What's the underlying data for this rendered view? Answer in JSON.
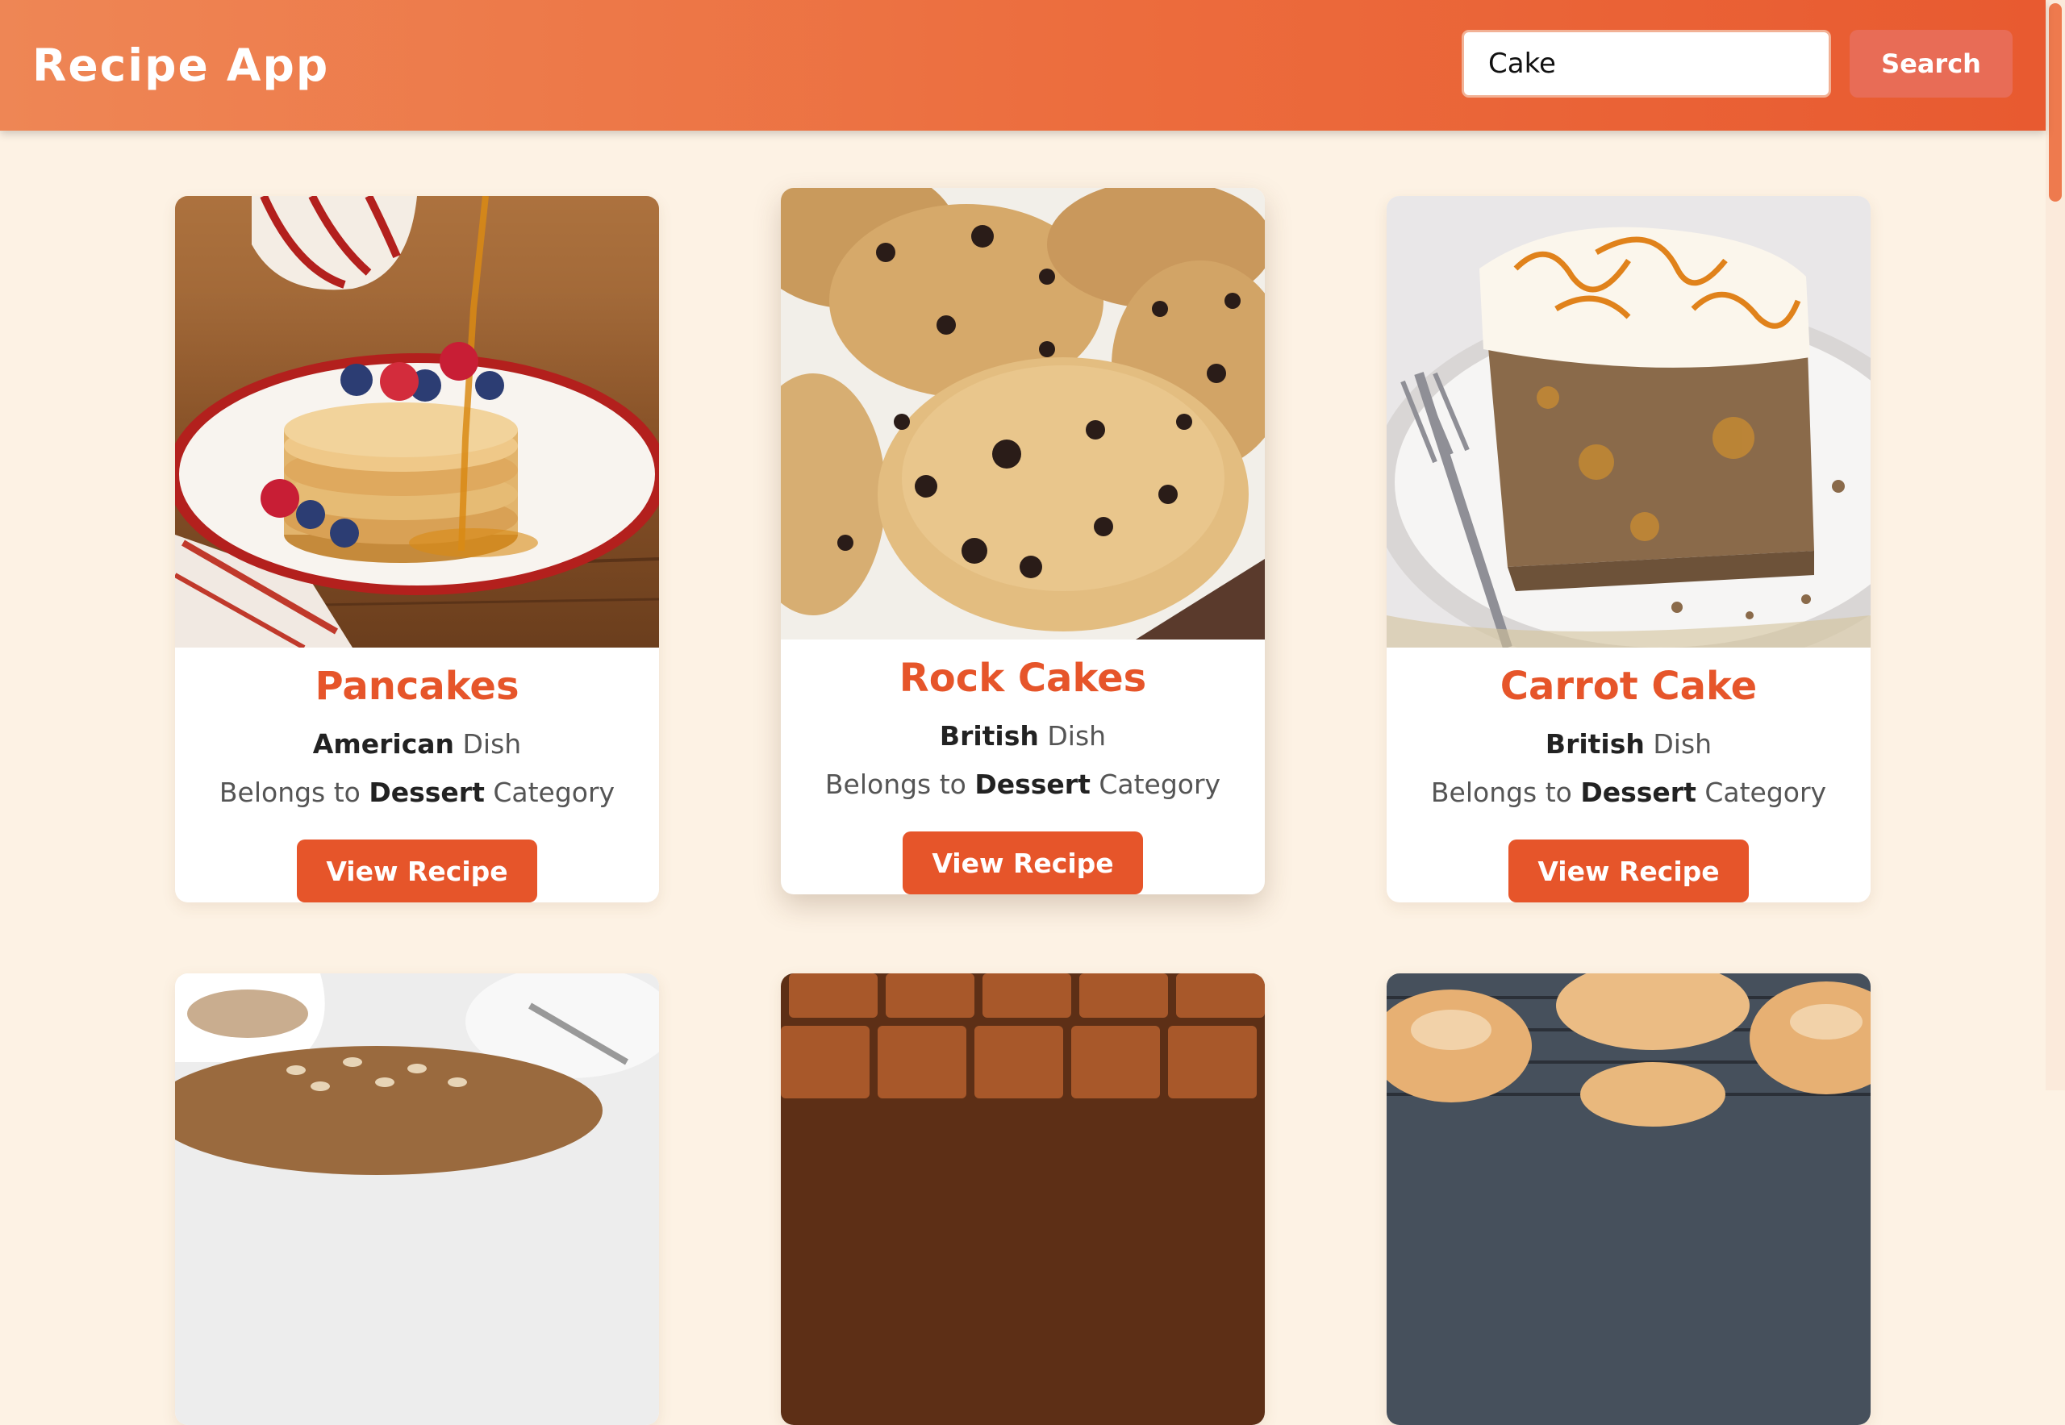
{
  "header": {
    "title": "Recipe App",
    "search_value": "Cake",
    "search_label": "Search"
  },
  "cards": [
    {
      "title": "Pancakes",
      "area": "American",
      "area_suffix": " Dish",
      "category_prefix": "Belongs to ",
      "category": "Dessert",
      "category_suffix": " Category",
      "button": "View Recipe",
      "image": "pancakes-photo"
    },
    {
      "title": "Rock Cakes",
      "area": "British",
      "area_suffix": " Dish",
      "category_prefix": "Belongs to ",
      "category": "Dessert",
      "category_suffix": " Category",
      "button": "View Recipe",
      "image": "rock-cakes-photo"
    },
    {
      "title": "Carrot Cake",
      "area": "British",
      "area_suffix": " Dish",
      "category_prefix": "Belongs to ",
      "category": "Dessert",
      "category_suffix": " Category",
      "button": "View Recipe",
      "image": "carrot-cake-photo"
    },
    {
      "image": "nut-cake-photo"
    },
    {
      "image": "brownie-squares-photo"
    },
    {
      "image": "glazed-buns-photo"
    }
  ],
  "colors": {
    "accent": "#e6552a",
    "header_start": "#ee8655",
    "header_end": "#e85a30",
    "page_background": "#fdf2e4",
    "search_button": "#e86c56"
  }
}
